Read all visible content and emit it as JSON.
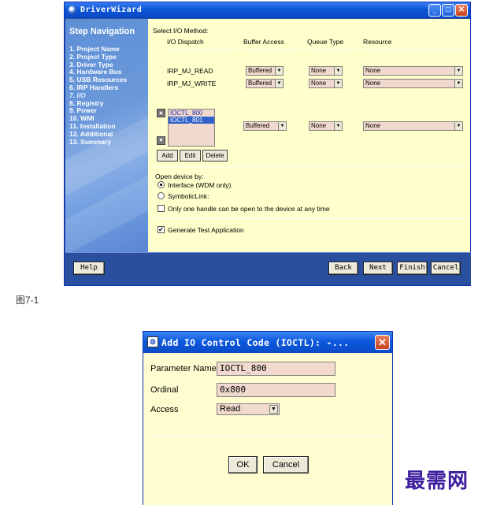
{
  "wizard": {
    "title": "DriverWizard",
    "controls": {
      "minimize": "_",
      "maximize": "□",
      "close": "✕"
    },
    "nav_title": "Step Navigation",
    "steps": [
      "1. Project Name",
      "2. Project Type",
      "3. Driver Type",
      "4. Hardware Bus",
      "5. USB Resources",
      "6. IRP Handlers",
      "7. I/O",
      "8. Registry",
      "9. Power",
      "10. WMI",
      "11. Installation",
      "12. Additional",
      "13. Summary"
    ],
    "active_step": "7. I/O",
    "section_label": "Select I/O Method:",
    "columns": [
      "I/O Dispatch",
      "Buffer Access",
      "Queue Type",
      "Resource"
    ],
    "rows": [
      {
        "dispatch": "IRP_MJ_READ",
        "buffer": "Buffered",
        "queue": "None",
        "resource": "None"
      },
      {
        "dispatch": "IRP_MJ_WRITE",
        "buffer": "Buffered",
        "queue": "None",
        "resource": "None"
      }
    ],
    "ioctl_list": [
      "IOCTL_800",
      "IOCTL_801"
    ],
    "ioctl_selected": "IOCTL_801",
    "ioctl_row": {
      "buffer": "Buffered",
      "queue": "None",
      "resource": "None"
    },
    "list_buttons": {
      "add": "Add",
      "edit": "Edit",
      "delete": "Delete"
    },
    "open_device_label": "Open device by:",
    "radio_interface": "Interface (WDM only)",
    "radio_symbolic": "SymbolicLink:",
    "checkbox_single_handle": "Only one handle can be open to the device at any time",
    "checkbox_test_app": "Generate Test Application",
    "test_app_checked": "✔",
    "buttons": {
      "help": "Help",
      "back": "Back",
      "next": "Next",
      "finish": "Finish",
      "cancel": "Cancel"
    }
  },
  "figure_caption": "图7-1",
  "dialog": {
    "title": "Add IO Control Code (IOCTL): -...",
    "close": "✕",
    "param_name_label": "Parameter Name",
    "param_name_value": "IOCTL_800",
    "ordinal_label": "Ordinal",
    "ordinal_value": "0x800",
    "access_label": "Access",
    "access_value": "Read",
    "ok": "OK",
    "cancel": "Cancel"
  },
  "watermark": "最需网",
  "colors": {
    "titlebar": "#0c55d8",
    "content_bg": "#ffffcc",
    "field_bg": "#f1d9cd",
    "bottom_bar": "#2a4f9e"
  },
  "icons": {
    "arrow_up": "▲",
    "arrow_down": "▼",
    "combo_arrow": "▼",
    "dialog_icon": "⚙"
  }
}
